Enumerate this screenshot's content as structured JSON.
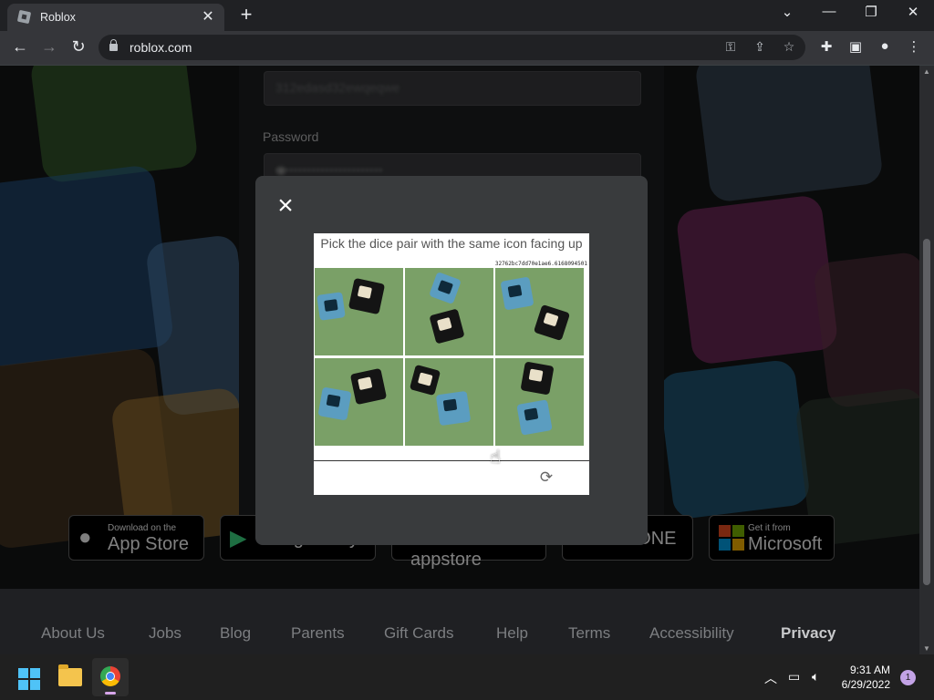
{
  "browser": {
    "tab_title": "Roblox",
    "tab_close": "✕",
    "new_tab": "+",
    "url": "roblox.com",
    "window_controls": {
      "tab_list": "⌄",
      "minimize": "—",
      "restore": "❐",
      "close": "✕"
    },
    "icons": [
      "back-icon",
      "forward-icon",
      "reload-icon",
      "lock-icon",
      "key-icon",
      "share-icon",
      "star-icon",
      "extensions-icon",
      "sidepanel-icon",
      "profile-icon",
      "menu-icon"
    ]
  },
  "login": {
    "username_value": "312edasd32ewqeqwe",
    "password_label": "Password",
    "password_value": "••••••••••••••••••••••••"
  },
  "captcha": {
    "prompt": "Pick the dice pair with the same icon facing up",
    "hash": "32762bc7dd70e1ae6.6168094501",
    "cells": 6
  },
  "stores": [
    {
      "small": "Download on the",
      "big": "App Store"
    },
    {
      "small": "",
      "big": "Google Play"
    },
    {
      "small": "",
      "big": "amazon appstore"
    },
    {
      "small": "",
      "big": "XBOX ONE"
    },
    {
      "small": "Get it from",
      "big": "Microsoft"
    }
  ],
  "footer": {
    "links": [
      "About Us",
      "Jobs",
      "Blog",
      "Parents",
      "Gift Cards",
      "Help",
      "Terms",
      "Accessibility",
      "Privacy"
    ]
  },
  "taskbar": {
    "time": "9:31 AM",
    "date": "6/29/2022",
    "notification_count": "1"
  },
  "colors": {
    "accent": "#4fc3f7",
    "modal": "#393b3d",
    "page_bg": "#151617"
  }
}
